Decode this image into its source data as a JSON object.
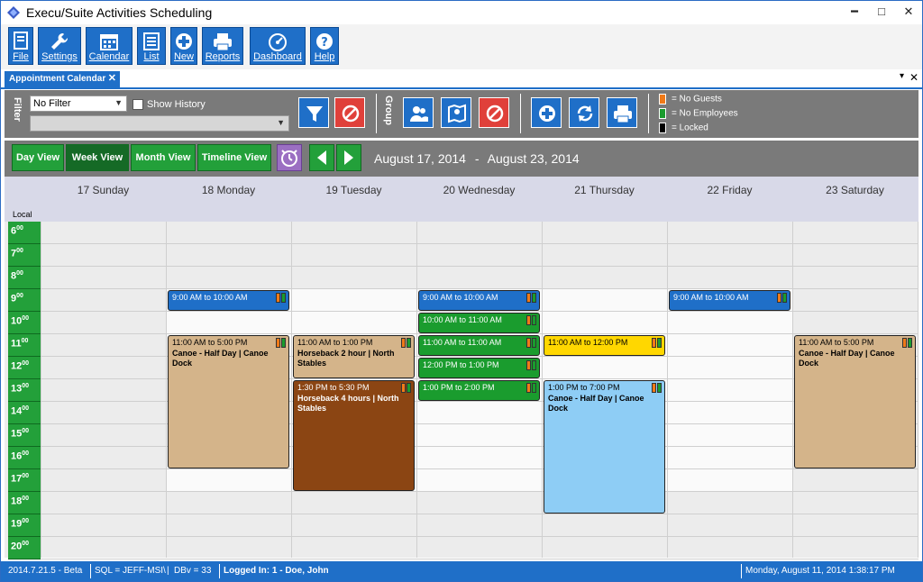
{
  "window": {
    "title": "Execu/Suite Activities Scheduling",
    "controls": {
      "minimize": "━",
      "maximize": "□",
      "close": "✕"
    }
  },
  "toolbar": {
    "buttons": [
      {
        "label": "File",
        "icon": "file-icon"
      },
      {
        "label": "Settings",
        "icon": "wrench-icon"
      },
      {
        "label": "Calendar",
        "icon": "calendar-icon"
      },
      {
        "label": "List",
        "icon": "list-icon"
      },
      {
        "label": "New",
        "icon": "plus-icon"
      },
      {
        "label": "Reports",
        "icon": "printer-icon"
      },
      {
        "label": "Dashboard",
        "icon": "gauge-icon"
      },
      {
        "label": "Help",
        "icon": "question-icon"
      }
    ]
  },
  "tabs": {
    "active": "Appointment Calendar",
    "close_glyph": "✕",
    "pin_glyph": "▾"
  },
  "filter": {
    "section_label": "Filter",
    "filter_select_value": "No Filter",
    "show_history_label": "Show History",
    "group_label": "Group"
  },
  "legend": [
    {
      "label": "= No Guests",
      "color": "#f07a18"
    },
    {
      "label": "= No Employees",
      "color": "#1a9c2e"
    },
    {
      "label": "= Locked",
      "color": "#000000"
    }
  ],
  "views": {
    "buttons": [
      "Day View",
      "Week View",
      "Month View",
      "Timeline View"
    ],
    "active": "Week View",
    "date_from": "August 17, 2014",
    "date_sep": "-",
    "date_to": "August 23, 2014"
  },
  "calendar": {
    "timezone_label": "Local",
    "days": [
      "17 Sunday",
      "18 Monday",
      "19 Tuesday",
      "20 Wednesday",
      "21 Thursday",
      "22 Friday",
      "23 Saturday"
    ],
    "hours": [
      {
        "hour": "6",
        "minutes": "00"
      },
      {
        "hour": "7",
        "minutes": "00"
      },
      {
        "hour": "8",
        "minutes": "00"
      },
      {
        "hour": "9",
        "minutes": "00"
      },
      {
        "hour": "10",
        "minutes": "00"
      },
      {
        "hour": "11",
        "minutes": "00"
      },
      {
        "hour": "12",
        "minutes": "00"
      },
      {
        "hour": "13",
        "minutes": "00"
      },
      {
        "hour": "14",
        "minutes": "00"
      },
      {
        "hour": "15",
        "minutes": "00"
      },
      {
        "hour": "16",
        "minutes": "00"
      },
      {
        "hour": "17",
        "minutes": "00"
      },
      {
        "hour": "18",
        "minutes": "00"
      },
      {
        "hour": "19",
        "minutes": "00"
      },
      {
        "hour": "20",
        "minutes": "00"
      }
    ],
    "appointments": [
      {
        "day": 1,
        "start": 9,
        "end": 10,
        "time": "9:00 AM to 10:00 AM",
        "desc": "",
        "color": "#1f6fc8",
        "text": "#ffffff"
      },
      {
        "day": 1,
        "start": 11,
        "end": 17,
        "time": "11:00 AM to 5:00 PM",
        "desc": "Canoe - Half Day | Canoe Dock",
        "color": "#d4b48a",
        "text": "#000000"
      },
      {
        "day": 2,
        "start": 11,
        "end": 13,
        "time": "11:00 AM to 1:00 PM",
        "desc": "Horseback 2 hour | North Stables",
        "color": "#d4b48a",
        "text": "#000000"
      },
      {
        "day": 2,
        "start": 13,
        "end": 18,
        "time": "1:30 PM to 5:30 PM",
        "desc": "Horseback 4 hours | North Stables",
        "color": "#8b4513",
        "text": "#ffffff"
      },
      {
        "day": 3,
        "start": 9,
        "end": 10,
        "time": "9:00 AM to 10:00 AM",
        "desc": "",
        "color": "#1f6fc8",
        "text": "#ffffff"
      },
      {
        "day": 3,
        "start": 10,
        "end": 11,
        "time": "10:00 AM to 11:00 AM",
        "desc": "",
        "color": "#1a9c2e",
        "text": "#ffffff"
      },
      {
        "day": 3,
        "start": 11,
        "end": 12,
        "time": "11:00 AM to 11:00 AM",
        "desc": "",
        "color": "#1a9c2e",
        "text": "#ffffff"
      },
      {
        "day": 3,
        "start": 12,
        "end": 13,
        "time": "12:00 PM to 1:00 PM",
        "desc": "",
        "color": "#1a9c2e",
        "text": "#ffffff"
      },
      {
        "day": 3,
        "start": 13,
        "end": 14,
        "time": "1:00 PM to 2:00 PM",
        "desc": "",
        "color": "#1a9c2e",
        "text": "#ffffff"
      },
      {
        "day": 4,
        "start": 11,
        "end": 12,
        "time": "11:00 AM to 12:00 PM",
        "desc": "",
        "color": "#ffd700",
        "text": "#000000"
      },
      {
        "day": 4,
        "start": 13,
        "end": 19,
        "time": "1:00 PM to 7:00 PM",
        "desc": "Canoe - Half Day | Canoe Dock",
        "color": "#8ecdf5",
        "text": "#000000"
      },
      {
        "day": 5,
        "start": 9,
        "end": 10,
        "time": "9:00 AM to 10:00 AM",
        "desc": "",
        "color": "#1f6fc8",
        "text": "#ffffff"
      },
      {
        "day": 6,
        "start": 11,
        "end": 17,
        "time": "11:00 AM to 5:00 PM",
        "desc": "Canoe - Half Day | Canoe Dock",
        "color": "#d4b48a",
        "text": "#000000"
      }
    ]
  },
  "status": {
    "version": "2014.7.21.5 - Beta",
    "sql": "SQL = JEFF-MSI\\",
    "dbv": "DBv = 33",
    "logged_in": "Logged In: 1 - Doe, John",
    "datetime": "Monday, August 11, 2014  1:38:17 PM"
  }
}
